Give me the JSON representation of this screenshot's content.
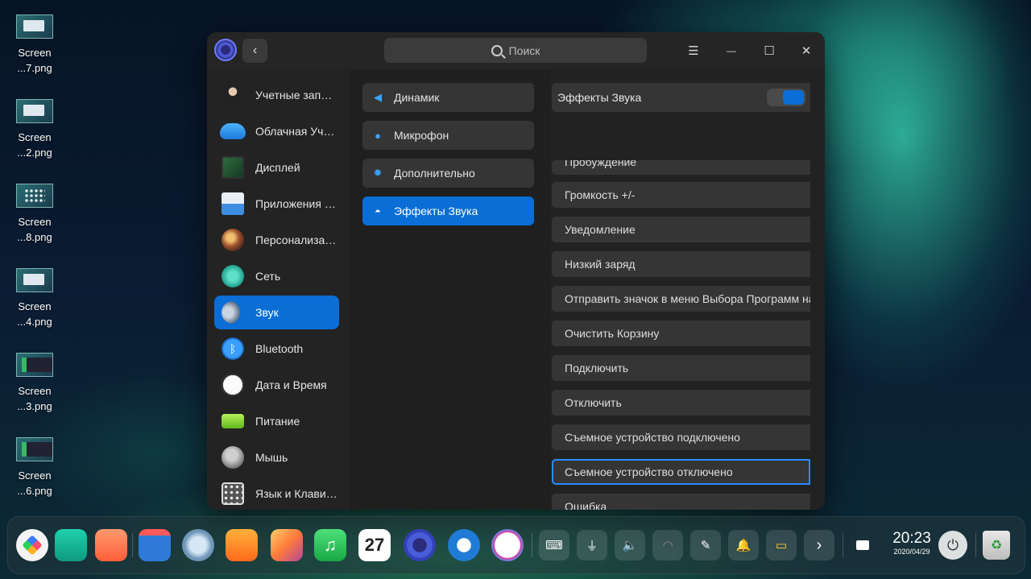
{
  "desktop": {
    "icons": [
      {
        "line1": "Screen",
        "line2": "...7.png",
        "thumb": "light"
      },
      {
        "line1": "Screen",
        "line2": "...2.png",
        "thumb": "light"
      },
      {
        "line1": "Screen",
        "line2": "...8.png",
        "thumb": "grid"
      },
      {
        "line1": "Screen",
        "line2": "...4.png",
        "thumb": "light"
      },
      {
        "line1": "Screen",
        "line2": "...3.png",
        "thumb": "dark"
      },
      {
        "line1": "Screen",
        "line2": "...6.png",
        "thumb": "dark"
      }
    ]
  },
  "window": {
    "back_icon": "chevron-left-icon",
    "search_placeholder": "Поиск",
    "controls": {
      "menu": "☰",
      "minimize": "—",
      "maximize": "☐",
      "close": "✕"
    }
  },
  "sidebar": {
    "items": [
      {
        "label": "Учетные записи",
        "icon": "accounts-icon",
        "color": "#3a2626"
      },
      {
        "label": "Облачная Учетная запись",
        "icon": "cloud-icon",
        "color": "#2d8fe6"
      },
      {
        "label": "Дисплей",
        "icon": "display-icon",
        "color": "#1f5d3a"
      },
      {
        "label": "Приложения по умолчанию",
        "icon": "default-apps-icon",
        "color": "#c9d6e8"
      },
      {
        "label": "Персонализация",
        "icon": "personalization-icon",
        "color": "#8a5a3a"
      },
      {
        "label": "Сеть",
        "icon": "network-icon",
        "color": "#2ab3a0"
      },
      {
        "label": "Звук",
        "icon": "sound-icon",
        "color": "#5b6f86"
      },
      {
        "label": "Bluetooth",
        "icon": "bluetooth-icon",
        "color": "#1d86e0"
      },
      {
        "label": "Дата и Время",
        "icon": "clock-icon",
        "color": "#e8e8e8"
      },
      {
        "label": "Питание",
        "icon": "battery-icon",
        "color": "#7bd12f"
      },
      {
        "label": "Мышь",
        "icon": "mouse-icon",
        "color": "#9a9a9a"
      },
      {
        "label": "Язык и  Клавиатура",
        "icon": "keyboard-icon",
        "color": "#d0d0d0"
      }
    ],
    "active_index": 6
  },
  "middle": {
    "items": [
      {
        "label": "Динамик",
        "icon": "speaker-icon",
        "glyph": "◀"
      },
      {
        "label": "Микрофон",
        "icon": "microphone-icon",
        "glyph": "●"
      },
      {
        "label": "Дополнительно",
        "icon": "gear-icon",
        "glyph": "✹"
      },
      {
        "label": "Эффекты Звука",
        "icon": "sound-effects-icon",
        "glyph": "◓"
      }
    ],
    "active_index": 3
  },
  "right": {
    "header_label": "Эффекты Звука",
    "toggle_on": true,
    "rows": [
      "Пробуждение",
      "Громкость +/-",
      "Уведомление",
      "Низкий заряд",
      "Отправить значок в меню Выбора Программ на",
      "Очистить Корзину",
      "Подключить",
      "Отключить",
      "Съемное устройство подключено",
      "Съемное устройство отключено",
      "Ошибка"
    ],
    "focused_index": 9
  },
  "dock": {
    "apps": [
      {
        "name": "launcher-icon",
        "color": "#f2f2f2"
      },
      {
        "name": "file-manager-icon",
        "color": "#18b59a"
      },
      {
        "name": "app-store-icon",
        "color": "#ff7a52"
      },
      {
        "name": "mail-icon",
        "color": "#2f7ad8"
      },
      {
        "name": "browser-icon",
        "color": "#8fb7d6"
      },
      {
        "name": "shop-icon",
        "color": "#ff8a1f"
      },
      {
        "name": "photos-icon",
        "color": "#ffa23a"
      },
      {
        "name": "music-icon",
        "color": "#2bd05a"
      },
      {
        "name": "calendar-icon",
        "color": "#ffffff"
      },
      {
        "name": "settings-icon",
        "color": "#3340b8"
      },
      {
        "name": "handshake-icon",
        "color": "#1f7bd6"
      },
      {
        "name": "draw-icon",
        "color": "#ffffff"
      }
    ],
    "calendar_day": "27",
    "tray": [
      {
        "name": "keyboard-tray-icon",
        "glyph": "⌨"
      },
      {
        "name": "usb-icon",
        "glyph": "⏚"
      },
      {
        "name": "volume-icon",
        "glyph": "🔈"
      },
      {
        "name": "wifi-icon",
        "glyph": "◠"
      },
      {
        "name": "pen-icon",
        "glyph": "✎"
      },
      {
        "name": "bell-icon",
        "glyph": "🔔"
      },
      {
        "name": "battery-tray-icon",
        "glyph": "▭"
      },
      {
        "name": "chevron-right-icon",
        "glyph": "›"
      }
    ],
    "clock_time": "20:23",
    "clock_date": "2020/04/29"
  }
}
